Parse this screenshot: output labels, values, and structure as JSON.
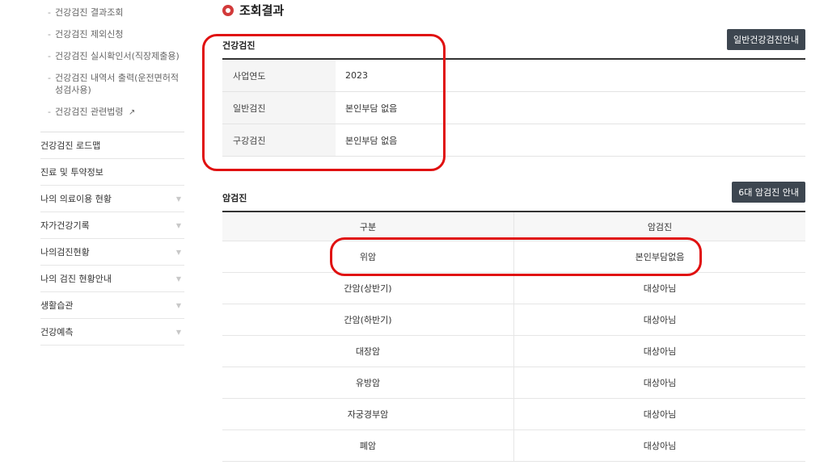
{
  "sidebar": {
    "sub_items": [
      {
        "label": "건강검진 결과조회"
      },
      {
        "label": "건강검진 제외신청"
      },
      {
        "label": "건강검진 실시확인서(직장제출용)"
      },
      {
        "label": "건강검진 내역서 출력(운전면허적성검사용)"
      },
      {
        "label": "건강검진 관련법령",
        "external": "↗"
      }
    ],
    "menu_items": [
      {
        "label": "건강검진 로드맵"
      },
      {
        "label": "진료 및 투약정보"
      },
      {
        "label": "나의 의료이용 현황",
        "arrow": "▼"
      },
      {
        "label": "자가건강기록",
        "arrow": "▼"
      },
      {
        "label": "나의검진현황",
        "arrow": "▼"
      },
      {
        "label": "나의 검진 현황안내",
        "arrow": "▼"
      },
      {
        "label": "생활습관",
        "arrow": "▼"
      },
      {
        "label": "건강예측",
        "arrow": "▼"
      }
    ]
  },
  "main": {
    "result_title": "조회결과",
    "health": {
      "title": "건강검진",
      "button": "일반건강검진안내",
      "rows": [
        {
          "label": "사업연도",
          "value": "2023"
        },
        {
          "label": "일반검진",
          "value": "본인부담 없음"
        },
        {
          "label": "구강검진",
          "value": "본인부담 없음"
        }
      ]
    },
    "cancer": {
      "title": "암검진",
      "button": "6대 암검진 안내",
      "headers": [
        "구분",
        "암검진"
      ],
      "rows": [
        {
          "type": "위암",
          "status": "본인부담없음"
        },
        {
          "type": "간암(상반기)",
          "status": "대상아님"
        },
        {
          "type": "간암(하반기)",
          "status": "대상아님"
        },
        {
          "type": "대장암",
          "status": "대상아님"
        },
        {
          "type": "유방암",
          "status": "대상아님"
        },
        {
          "type": "자궁경부암",
          "status": "대상아님"
        },
        {
          "type": "폐암",
          "status": "대상아님"
        }
      ]
    }
  }
}
